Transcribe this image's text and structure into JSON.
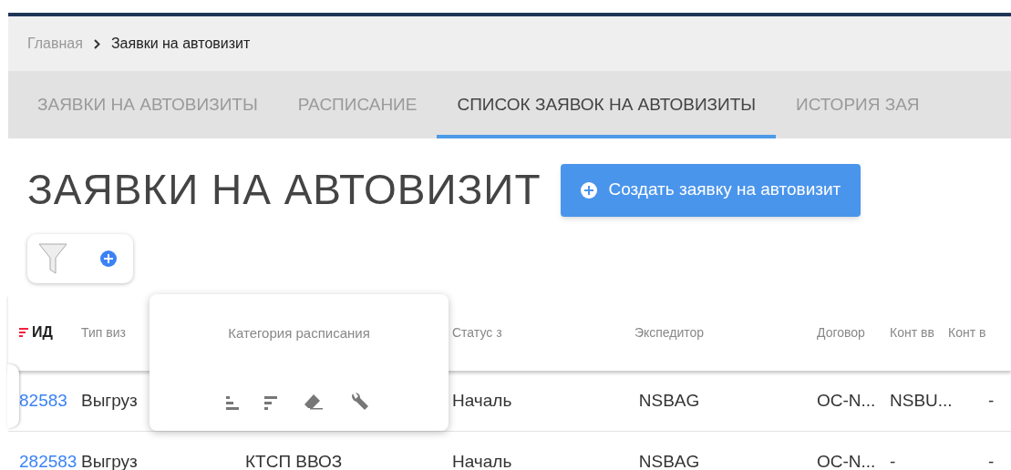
{
  "breadcrumb": [
    {
      "label": "Главная",
      "current": false
    },
    {
      "label": "Заявки на автовизит",
      "current": true
    }
  ],
  "tabs": [
    {
      "label": "ЗАЯВКИ НА АВТОВИЗИТЫ",
      "selected": false
    },
    {
      "label": "РАСПИСАНИЕ",
      "selected": false
    },
    {
      "label": "СПИСОК ЗАЯВОК НА АВТОВИЗИТЫ",
      "selected": true
    },
    {
      "label": "ИСТОРИЯ ЗАЯ",
      "selected": false
    }
  ],
  "page_title": "ЗАЯВКИ НА АВТОВИЗИТ",
  "create_button": {
    "label": "Создать заявку на автовизит"
  },
  "table": {
    "columns": {
      "id": {
        "label": "ИД",
        "sorted": true
      },
      "visit_type": {
        "label": "Тип виз",
        "sorted": false
      },
      "status": {
        "label": "Статус з",
        "sorted": false
      },
      "forwarder": {
        "label": "Экспедитор",
        "sorted": false
      },
      "contract": {
        "label": "Договор",
        "sorted": false
      },
      "cont_1": {
        "label": "Конт вв",
        "sorted": false
      },
      "cont_2": {
        "label": "Конт в",
        "sorted": false
      }
    },
    "rows": [
      {
        "id": "82583",
        "visit_type": "Выгруз",
        "status": "Началь",
        "forwarder": "NSBAG",
        "contract": "OC-N...",
        "cont_1": "NSBU...",
        "cont_2": "-"
      },
      {
        "id": "282583",
        "visit_type": "Выгруз",
        "category": "КТСП ВВОЗ",
        "status": "Началь",
        "forwarder": "NSBAG",
        "contract": "OC-N...",
        "cont_1": "-",
        "cont_2": "-"
      }
    ]
  },
  "column_menu": {
    "title": "Категория расписания"
  }
}
